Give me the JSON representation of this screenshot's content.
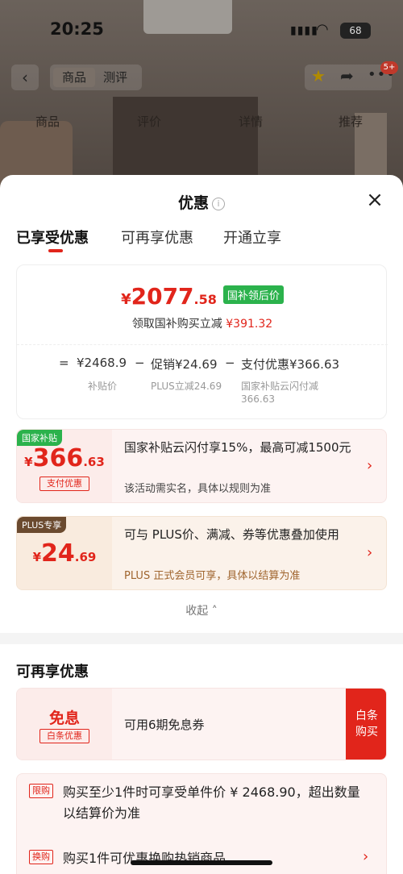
{
  "status_bar": {
    "time": "20:25",
    "battery": "68"
  },
  "bg_nav": {
    "tab_goods": "商品",
    "tab_review": "测评",
    "cart_badge": "5+"
  },
  "bg_subtabs": [
    "商品",
    "评价",
    "详情",
    "推荐"
  ],
  "sheet": {
    "title": "优惠",
    "close": "×"
  },
  "tabs": [
    {
      "label": "已享受优惠",
      "active": true
    },
    {
      "label": "可再享优惠",
      "active": false
    },
    {
      "label": "开通立享",
      "active": false
    }
  ],
  "summary": {
    "price_currency": "¥",
    "price_int": "2077",
    "price_dec": ".58",
    "price_tag": "国补领后价",
    "sub_label": "领取国补购买立减",
    "sub_amount": "¥391.32",
    "calc": [
      "=",
      "¥2468.9",
      "−",
      "促销¥24.69",
      "−",
      "支付优惠¥366.63"
    ],
    "calc_sub": [
      "补贴价",
      "PLUS立减24.69",
      "国家补贴云闪付减",
      "366.63"
    ]
  },
  "offers": [
    {
      "corner": "国家补贴",
      "currency": "¥",
      "int": "366",
      "dec": ".63",
      "type_tag": "支付优惠",
      "desc": "国家补贴云闪付享15%，最高可减1500元",
      "note": "该活动需实名，具体以规则为准"
    },
    {
      "corner": "PLUS专享",
      "currency": "¥",
      "int": "24",
      "dec": ".69",
      "desc": "可与 PLUS价、满减、券等优惠叠加使用",
      "note": "PLUS 正式会员可享，具体以结算为准"
    }
  ],
  "collapse": "收起",
  "more_section": {
    "title": "可再享优惠",
    "baitiao": {
      "big": "免息",
      "type_tag": "白条优惠",
      "desc": "可用6期免息券",
      "buy": "白条购买"
    },
    "rules": [
      {
        "tag": "限购",
        "text": "购买至少1件时可享受单件价 ¥ 2468.90，超出数量以结算价为准"
      },
      {
        "tag": "换购",
        "text": "购买1件可优惠换购热销商品"
      }
    ]
  },
  "colors": {
    "accent_red": "#e1251b",
    "green_tag": "#2bb24c",
    "plus_brown": "#6b4a2f"
  }
}
